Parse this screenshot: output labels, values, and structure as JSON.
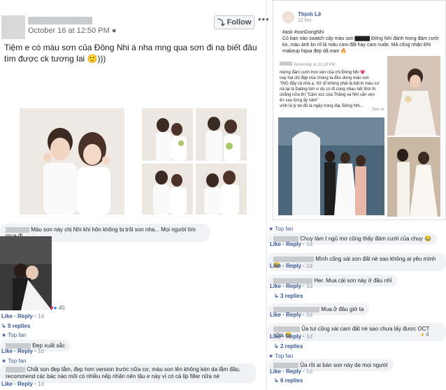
{
  "post": {
    "date": "October 16 at 12:50 PM",
    "follow_label": "Follow",
    "more_label": "•••",
    "text": "Tiệm e có màu sơn của Đông Nhi á nha mng qua sơn đi nạ biết đâu tìm được ck tương lai 🙂)))"
  },
  "right_post": {
    "name": "Thịnh Lê",
    "hours": "12 hrs",
    "text": "#ask #sonDongNhi\nCó bạn nào swatch cây màu son ▇▇▇▇ Đông Nhi đánh trong đám cưới ko, màu ảnh ko rõ là màu cam đất hay cam nude. Mà công nhận ĐN makeup hqua đẹp dã man 🔥",
    "shared_time": "Yesterday at 11:18 PM",
    "shared_text": "mừng đám cưới trọn vẹn của chị Đông Nhi 💗\nnay hai chị đẹp của chúng ta đều dùng màu son\n\"ING đấy cả nhà ạ. Sở dĩ không phải là bất kì màu sơ\nnà lại là Dating bởi vì dù có đi cùng nhau hết thời th\nchẳng nữa thì \"Cảm xúc của Thắng và Nhi vẫn vẹn\nên sau từng ấy năm\"\nvình là lý do đủ là ngày trọng đại, Đông Nhi...",
    "see_more": "See m"
  },
  "left_comments": [
    {
      "text": "Màu son này chị Nhi khi hôn không bị trôi son nha... Mọi người tìm mua đi ...",
      "reactions": "40",
      "like": "Like",
      "reply": "Reply",
      "time": "1d",
      "replies": "9 replies"
    },
    {
      "topfan": "Top fan",
      "text": "Đẹp xuất sắc",
      "like": "Like",
      "reply": "Reply",
      "time": "1d"
    },
    {
      "topfan": "Top fan",
      "text": "Chất son đẹp lắm, đẹp hơn version trước nữa cơ, màu son lên không kén da lắm đâu, recommend các bác nào môi có nhiều nếp nhăn nên tậu e này vì có cả lip filler nữa nè",
      "like": "Like",
      "reply": "Reply",
      "time": "1d"
    }
  ],
  "right_comments": [
    {
      "topfan": "Top fan",
      "text": "Chuy làm t ngủ mơ cũng thấy đám cưới của chuy 😂",
      "like": "Like",
      "reply": "Reply",
      "time": "1d"
    },
    {
      "text": "Mình cũng sài son đất nè sao không ai yêu mình 😂",
      "like": "Like",
      "reply": "Reply",
      "time": "1d"
    },
    {
      "text": "Her. Mua cái son này ở đâu nhỉ",
      "like": "Like",
      "reply": "Reply",
      "time": "1d",
      "replies": "3 replies"
    },
    {
      "text": "Mua ở đâu giờ ta",
      "like": "Like",
      "reply": "Reply",
      "time": "1d"
    },
    {
      "text": "Ủa tui cũng xài cam đất nè sao chưa lấy được OCT nữa 😂",
      "like": "Like",
      "reply": "Reply",
      "time": "1d",
      "reactions": "4",
      "replies": "2 replies"
    },
    {
      "topfan": "Top fan",
      "text": "Ủa rồi ai bán son này dẹ mọi người",
      "like": "Like",
      "reply": "Reply",
      "time": "1d",
      "replies": "6 replies"
    }
  ],
  "colors": {
    "link": "#385898",
    "bubble": "#f0f2f5",
    "topfan": "#3b5998"
  }
}
